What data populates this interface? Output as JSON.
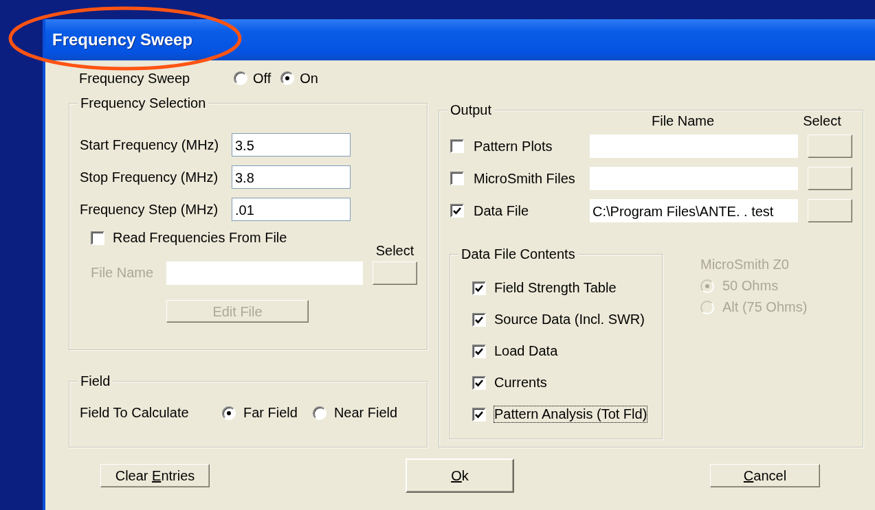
{
  "window": {
    "title": "Frequency Sweep"
  },
  "annotation": {
    "kind": "ellipse"
  },
  "frequency_sweep": {
    "label": "Frequency Sweep",
    "options": [
      {
        "label": "Off",
        "selected": false
      },
      {
        "label": "On",
        "selected": true
      }
    ]
  },
  "frequency_selection": {
    "title": "Frequency Selection",
    "fields": [
      {
        "label": "Start Frequency (MHz)",
        "value": "3.5"
      },
      {
        "label": "Stop Frequency (MHz)",
        "value": "3.8"
      },
      {
        "label": "Frequency Step (MHz)",
        "value": ".01"
      }
    ],
    "read_from_file": {
      "label": "Read Frequencies From File",
      "checked": false
    },
    "select_label": "Select",
    "file_name_label": "File Name",
    "disabled": true,
    "edit_button": "Edit File"
  },
  "field": {
    "title": "Field",
    "label": "Field To Calculate",
    "options": [
      {
        "label": "Far Field",
        "selected": true
      },
      {
        "label": "Near Field",
        "selected": false
      }
    ]
  },
  "output": {
    "title": "Output",
    "columns": [
      "File Name",
      "Select"
    ],
    "rows": [
      {
        "label": "Pattern Plots",
        "checked": false
      },
      {
        "label": "MicroSmith Files",
        "checked": false
      },
      {
        "label": "Data File",
        "checked": true,
        "value": "C:\\Program Files\\ANTE. . test"
      }
    ]
  },
  "data_file_contents": {
    "title": "Data File Contents",
    "items": [
      {
        "label": "Field Strength Table",
        "checked": true,
        "focused": false
      },
      {
        "label": "Source Data (Incl. SWR)",
        "checked": true,
        "focused": false
      },
      {
        "label": "Load Data",
        "checked": true,
        "focused": false
      },
      {
        "label": "Currents",
        "checked": true,
        "focused": false
      },
      {
        "label": "Pattern Analysis (Tot Fld)",
        "checked": true,
        "focused": true
      }
    ]
  },
  "microsmith_z0": {
    "title": "MicroSmith Z0",
    "disabled": true,
    "options": [
      {
        "label": "50 Ohms",
        "selected": true
      },
      {
        "label": "Alt (75 Ohms)",
        "selected": false
      }
    ]
  },
  "buttons": [
    {
      "before": "Clear ",
      "key": "E",
      "after": "ntries",
      "default": false
    },
    {
      "key": "O",
      "after": "k",
      "default": true
    },
    {
      "key": "C",
      "after": "ancel",
      "default": false
    }
  ]
}
